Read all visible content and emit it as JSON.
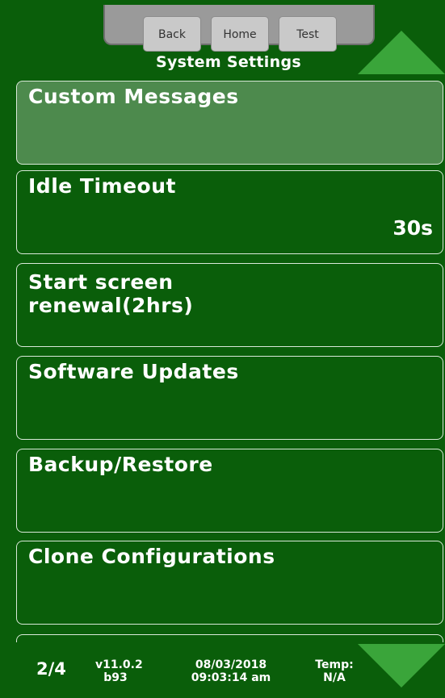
{
  "nav": {
    "back_label": "Back",
    "home_label": "Home",
    "test_label": "Test"
  },
  "page_title": "System Settings",
  "menu": {
    "items": [
      {
        "label": "Custom Messages",
        "value": "",
        "active": true
      },
      {
        "label": "Idle Timeout",
        "value": "30s",
        "active": false
      },
      {
        "label": "Start screen\nrenewal(2hrs)",
        "value": "",
        "active": false
      },
      {
        "label": "Software Updates",
        "value": "",
        "active": false
      },
      {
        "label": "Backup/Restore",
        "value": "",
        "active": false
      },
      {
        "label": "Clone Configurations",
        "value": "",
        "active": false
      }
    ]
  },
  "footer": {
    "page_indicator": "2/4",
    "version": "v11.0.2",
    "build": "b93",
    "date": "08/03/2018",
    "time": "09:03:14 am",
    "temp_label": "Temp:",
    "temp_value": "N/A"
  },
  "icons": {
    "scroll_up": "triangle-up-icon",
    "scroll_down": "triangle-down-icon"
  },
  "colors": {
    "background": "#0a5e0a",
    "active_item": "#4d8a4d",
    "arrow": "#3aa53a",
    "panel": "#9a9a9a",
    "button": "#c9c9c9"
  }
}
